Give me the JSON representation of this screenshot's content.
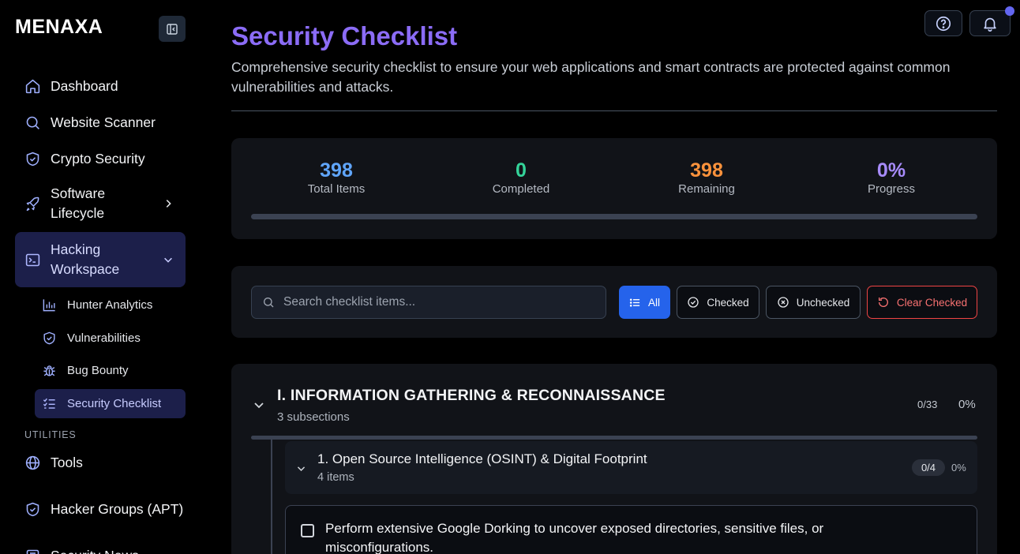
{
  "app": {
    "logo": "MENAXA"
  },
  "sidebar": {
    "items": [
      {
        "label": "Dashboard",
        "icon": "home-icon"
      },
      {
        "label": "Website Scanner",
        "icon": "search-icon"
      },
      {
        "label": "Crypto Security",
        "icon": "shield-icon"
      },
      {
        "label": "Software Lifecycle",
        "icon": "rocket-icon"
      },
      {
        "label": "Hacking Workspace",
        "icon": "terminal-icon"
      }
    ],
    "sub_items": [
      {
        "label": "Hunter Analytics",
        "icon": "bar-chart-icon"
      },
      {
        "label": "Vulnerabilities",
        "icon": "shield-check-icon"
      },
      {
        "label": "Bug Bounty",
        "icon": "bug-icon"
      },
      {
        "label": "Security Checklist",
        "icon": "list-checks-icon"
      }
    ],
    "utilities_label": "UTILITIES",
    "utilities": [
      {
        "label": "Tools",
        "icon": "globe-icon"
      },
      {
        "label": "Hacker Groups (APT)",
        "icon": "shield-icon"
      },
      {
        "label": "Security News",
        "icon": "newspaper-icon"
      }
    ]
  },
  "header": {
    "title": "Security Checklist",
    "description": "Comprehensive security checklist to ensure your web applications and smart contracts are protected against common vulnerabilities and attacks."
  },
  "stats": {
    "total": {
      "value": "398",
      "label": "Total Items",
      "color": "#60a5fa"
    },
    "completed": {
      "value": "0",
      "label": "Completed",
      "color": "#34d399"
    },
    "remaining": {
      "value": "398",
      "label": "Remaining",
      "color": "#fb923c"
    },
    "progress": {
      "value": "0%",
      "label": "Progress",
      "color": "#a78bfa"
    },
    "progress_fraction": 0
  },
  "filters": {
    "search_placeholder": "Search checklist items...",
    "all": "All",
    "checked": "Checked",
    "unchecked": "Unchecked",
    "clear": "Clear Checked"
  },
  "section": {
    "title": "I. INFORMATION GATHERING & RECONNAISSANCE",
    "subtitle": "3 subsections",
    "count": "0/33",
    "percent": "0%",
    "subsection": {
      "title": "1. Open Source Intelligence (OSINT) & Digital Footprint",
      "subtitle": "4 items",
      "count": "0/4",
      "percent": "0%"
    },
    "item": {
      "text": "Perform extensive Google Dorking to uncover exposed directories, sensitive files, or misconfigurations."
    }
  }
}
